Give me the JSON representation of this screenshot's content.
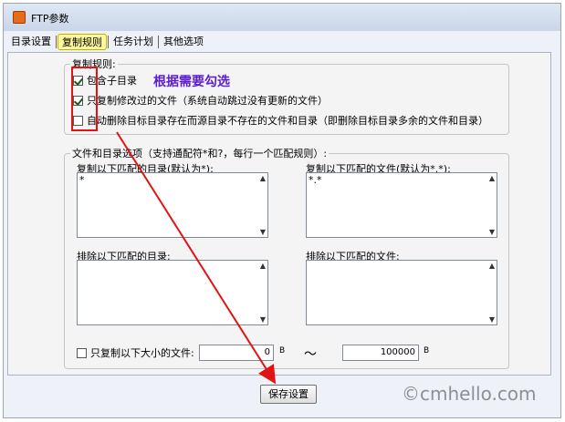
{
  "window": {
    "title": "FTP参数"
  },
  "tabs": [
    {
      "label": "目录设置"
    },
    {
      "label": "复制规则",
      "active": true
    },
    {
      "label": "任务计划"
    },
    {
      "label": "其他选项"
    }
  ],
  "copy_rules": {
    "legend": "复制规则:",
    "options": [
      {
        "label": "包含子目录",
        "checked": true
      },
      {
        "label": "只复制修改过的文件（系统自动跳过没有更新的文件）",
        "checked": true
      },
      {
        "label": "自动删除目标目录存在而源目录不存在的文件和目录（即删除目标目录多余的文件和目录）",
        "checked": false
      }
    ]
  },
  "annotation": {
    "hint": "根据需要勾选",
    "color": "#e01414"
  },
  "file_options": {
    "legend": "文件和目录选项（支持通配符*和?，每行一个匹配规则）:",
    "copy_dirs_label": "复制以下匹配的目录(默认为*):",
    "copy_dirs_value": "*",
    "copy_files_label": "复制以下匹配的文件(默认为*.*):",
    "copy_files_value": "*.*",
    "exclude_dirs_label": "排除以下匹配的目录:",
    "exclude_dirs_value": "",
    "exclude_files_label": "排除以下匹配的文件:",
    "exclude_files_value": "",
    "size_label": "只复制以下大小的文件:",
    "size_checked": false,
    "size_min": "0",
    "size_max": "100000",
    "size_unit": "B",
    "range_sep": "～"
  },
  "save_button": "保存设置",
  "watermark": "©cmhello.com"
}
